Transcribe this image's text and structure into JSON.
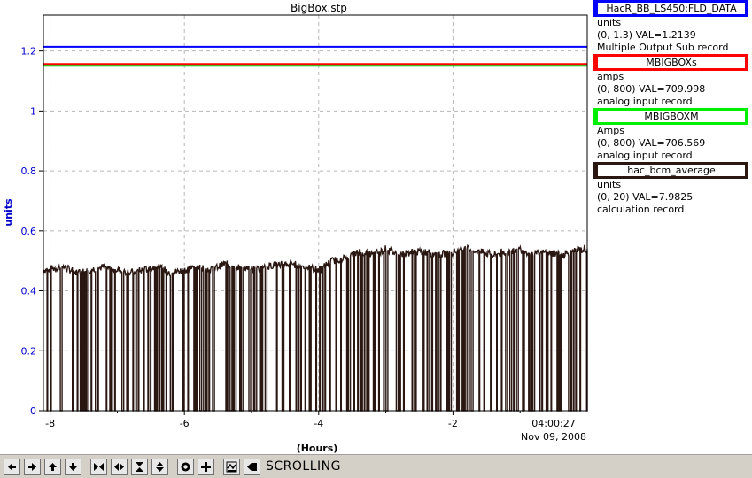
{
  "window_title": "BigBox.stp",
  "chart_data": {
    "type": "line",
    "title": "BigBox.stp",
    "xlabel": "(Hours)",
    "ylabel": "units",
    "xlim": [
      -8.1,
      0.0
    ],
    "ylim": [
      0,
      1.32
    ],
    "x_ticks": [
      -8,
      -6,
      -4,
      -2
    ],
    "x_tick_labels": [
      "-8",
      "-6",
      "-4",
      "-2"
    ],
    "y_ticks": [
      0,
      0.2,
      0.4,
      0.6,
      0.8,
      1,
      1.2
    ],
    "y_tick_labels": [
      "0",
      "0.2",
      "0.4",
      "0.6",
      "0.8",
      "1",
      "1.2"
    ],
    "end_time": "04:00:27",
    "end_date": "Nov 09, 2008",
    "grid": true,
    "series": [
      {
        "name": "HacR_BB_LS450:FLD_DATA",
        "color": "#0000ff",
        "x": [
          -8.1,
          0.0
        ],
        "y": [
          1.2139,
          1.2139
        ]
      },
      {
        "name": "MBIGBOXs",
        "color": "#ff0000",
        "x": [
          -8.1,
          0.0
        ],
        "y": [
          1.157,
          1.157
        ]
      },
      {
        "name": "MBIGBOXM",
        "color": "#00cc00",
        "x": [
          -8.1,
          0.0
        ],
        "y": [
          1.151,
          1.151
        ]
      },
      {
        "name": "hac_bcm_average",
        "color": "#2a1712",
        "x": [
          -8.1,
          -7.8,
          -7.6,
          -7.4,
          -7.2,
          -7.0,
          -6.8,
          -6.6,
          -6.4,
          -6.2,
          -6.0,
          -5.8,
          -5.6,
          -5.4,
          -5.2,
          -5.0,
          -4.8,
          -4.6,
          -4.4,
          -4.2,
          -4.0,
          -3.8,
          -3.6,
          -3.4,
          -3.2,
          -3.0,
          -2.8,
          -2.6,
          -2.4,
          -2.2,
          -2.0,
          -1.8,
          -1.6,
          -1.4,
          -1.2,
          -1.0,
          -0.8,
          -0.6,
          -0.4,
          -0.2,
          0.0
        ],
        "y": [
          0.47,
          0.48,
          0.46,
          0.47,
          0.48,
          0.47,
          0.46,
          0.47,
          0.48,
          0.46,
          0.47,
          0.48,
          0.47,
          0.49,
          0.48,
          0.47,
          0.48,
          0.49,
          0.49,
          0.48,
          0.47,
          0.5,
          0.51,
          0.53,
          0.52,
          0.54,
          0.52,
          0.53,
          0.53,
          0.52,
          0.53,
          0.54,
          0.53,
          0.52,
          0.53,
          0.54,
          0.52,
          0.53,
          0.52,
          0.53,
          0.54
        ]
      }
    ]
  },
  "legend": [
    {
      "name": "HacR_BB_LS450:FLD_DATA",
      "color": "#0000ff",
      "units": "units",
      "range": "(0, 1.3) VAL=1.2139",
      "record": "Multiple Output Sub record"
    },
    {
      "name": "MBIGBOXs",
      "color": "#ff0000",
      "units": "amps",
      "range": "(0, 800) VAL=709.998",
      "record": "analog input record"
    },
    {
      "name": "MBIGBOXM",
      "color": "#00ee00",
      "units": "Amps",
      "range": "(0, 800) VAL=706.569",
      "record": "analog input record"
    },
    {
      "name": "hac_bcm_average",
      "color": "#2a1712",
      "units": "units",
      "range": "(0, 20) VAL=7.9825",
      "record": "calculation record"
    }
  ],
  "toolbar": {
    "buttons": [
      "arrow-left-icon",
      "arrow-right-icon",
      "arrow-up-icon",
      "arrow-down-icon",
      "zoom-in-x-icon",
      "zoom-out-x-icon",
      "zoom-in-y-icon",
      "zoom-out-y-icon",
      "auto-scale-icon",
      "crosshair-icon",
      "toggle-graph-icon",
      "jump-end-icon"
    ],
    "mode_label": "SCROLLING"
  }
}
